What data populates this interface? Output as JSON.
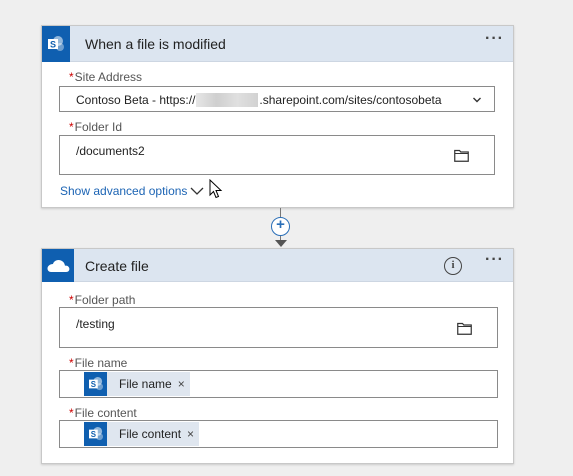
{
  "trigger": {
    "title": "When a file is modified",
    "icon": "sharepoint-icon",
    "more": "···",
    "site_address": {
      "label": "Site Address",
      "required_mark": "*",
      "value_prefix": "Contoso Beta - https://",
      "value_suffix": ".sharepoint.com/sites/contosobeta"
    },
    "folder_id": {
      "label": "Folder Id",
      "required_mark": "*",
      "value": "/documents2"
    },
    "advanced_link": "Show advanced options"
  },
  "action": {
    "title": "Create file",
    "icon": "onedrive-icon",
    "info": "i",
    "more": "···",
    "folder_path": {
      "label": "Folder path",
      "required_mark": "*",
      "value": "/testing"
    },
    "file_name": {
      "label": "File name",
      "required_mark": "*",
      "token_label": "File name",
      "token_close": "×"
    },
    "file_content": {
      "label": "File content",
      "required_mark": "*",
      "token_label": "File content",
      "token_close": "×"
    }
  },
  "add_step": "+",
  "colors": {
    "header_bg": "#dce5f0",
    "brand_blue": "#0f5fb0",
    "link": "#1c64b4",
    "required": "#cc0000"
  }
}
